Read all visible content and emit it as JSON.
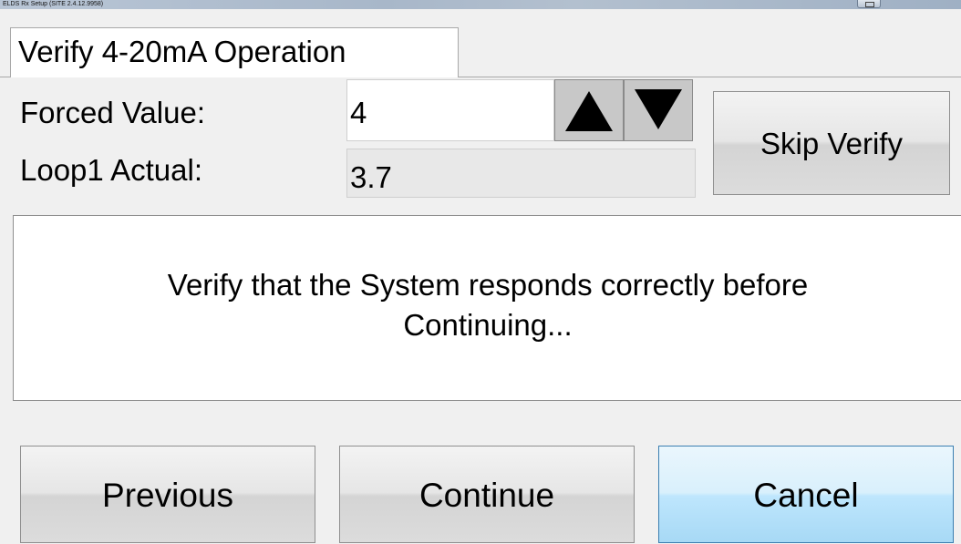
{
  "window": {
    "title": "ELDS Rx Setup (SITE 2.4.12.9958)"
  },
  "tab": {
    "label": "Verify 4-20mA Operation"
  },
  "forced": {
    "label": "Forced Value:",
    "value": "4"
  },
  "actual": {
    "label": "Loop1 Actual:",
    "value": "3.7"
  },
  "buttons": {
    "skip": "Skip Verify",
    "previous": "Previous",
    "continue": "Continue",
    "cancel": "Cancel"
  },
  "message": {
    "line1": "Verify that the System responds correctly before",
    "line2": "Continuing..."
  },
  "icons": {
    "increment": "triangle-up-icon",
    "decrement": "triangle-down-icon",
    "restore": "restore-window-icon"
  },
  "colors": {
    "window_bg": "#f0f0f0",
    "field_bg": "#ffffff",
    "readonly_bg": "#e8e8e8",
    "focused_button_border": "#3c7fb1"
  }
}
